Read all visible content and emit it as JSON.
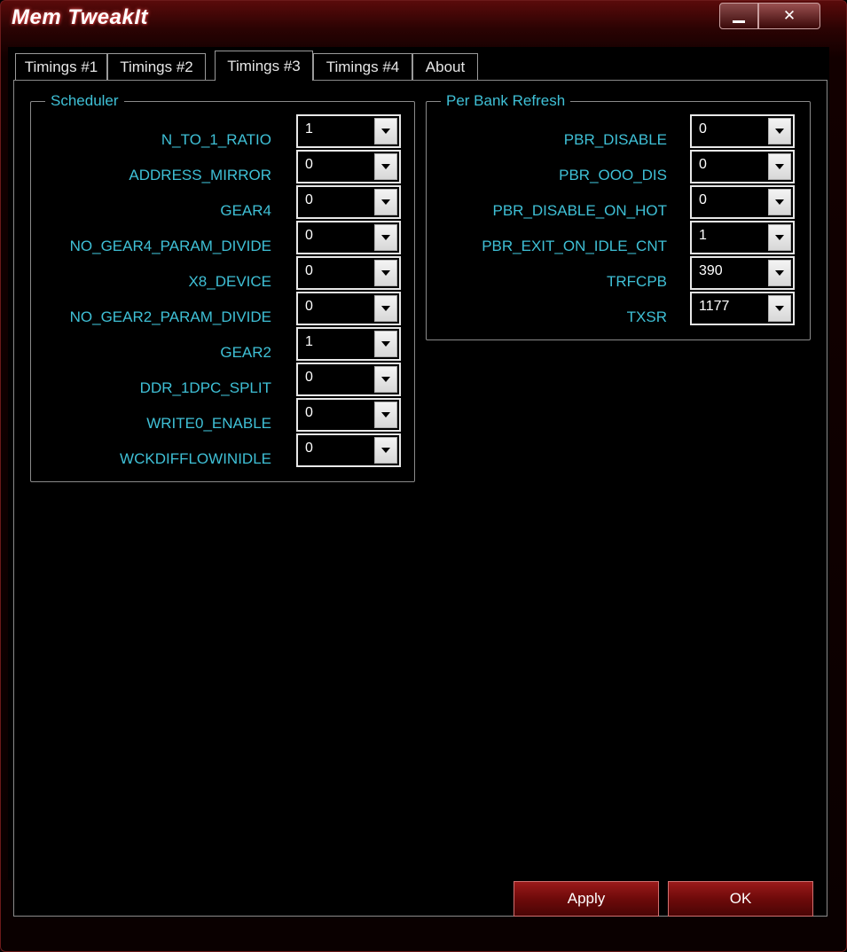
{
  "window": {
    "title": "Mem TweakIt",
    "close_glyph": "✕"
  },
  "tabs": [
    "Timings #1",
    "Timings #2",
    "Timings #3",
    "Timings #4",
    "About"
  ],
  "active_tab": "Timings #3",
  "scheduler": {
    "legend": "Scheduler",
    "rows": [
      {
        "label": "N_TO_1_RATIO",
        "value": "1"
      },
      {
        "label": "ADDRESS_MIRROR",
        "value": "0"
      },
      {
        "label": "GEAR4",
        "value": "0"
      },
      {
        "label": "NO_GEAR4_PARAM_DIVIDE",
        "value": "0"
      },
      {
        "label": "X8_DEVICE",
        "value": "0"
      },
      {
        "label": "NO_GEAR2_PARAM_DIVIDE",
        "value": "0"
      },
      {
        "label": "GEAR2",
        "value": "1"
      },
      {
        "label": "DDR_1DPC_SPLIT",
        "value": "0"
      },
      {
        "label": "WRITE0_ENABLE",
        "value": "0"
      },
      {
        "label": "WCKDIFFLOWINIDLE",
        "value": "0"
      }
    ]
  },
  "per_bank_refresh": {
    "legend": "Per Bank Refresh",
    "rows": [
      {
        "label": "PBR_DISABLE",
        "value": "0"
      },
      {
        "label": "PBR_OOO_DIS",
        "value": "0"
      },
      {
        "label": "PBR_DISABLE_ON_HOT",
        "value": "0"
      },
      {
        "label": "PBR_EXIT_ON_IDLE_CNT",
        "value": "1"
      },
      {
        "label": "TRFCPB",
        "value": "390"
      },
      {
        "label": "TXSR",
        "value": "1177"
      }
    ]
  },
  "footer": {
    "apply_label": "Apply",
    "ok_label": "OK"
  },
  "colors": {
    "label": "#3fc0d6",
    "accent": "#9b1a1a",
    "background": "#000000"
  },
  "icons": {
    "minimize": "minimize-icon",
    "close": "close-icon",
    "dropdown": "chevron-down-icon"
  }
}
